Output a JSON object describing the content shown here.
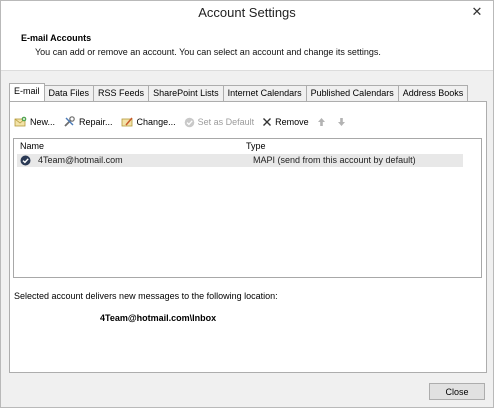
{
  "window": {
    "title": "Account Settings"
  },
  "header": {
    "title": "E-mail Accounts",
    "subtitle": "You can add or remove an account. You can select an account and change its settings."
  },
  "tabs": [
    {
      "label": "E-mail",
      "active": true
    },
    {
      "label": "Data Files"
    },
    {
      "label": "RSS Feeds"
    },
    {
      "label": "SharePoint Lists"
    },
    {
      "label": "Internet Calendars"
    },
    {
      "label": "Published Calendars"
    },
    {
      "label": "Address Books"
    }
  ],
  "toolbar": {
    "new": "New...",
    "repair": "Repair...",
    "change": "Change...",
    "set_default": "Set as Default",
    "remove": "Remove"
  },
  "list": {
    "col_name": "Name",
    "col_type": "Type",
    "rows": [
      {
        "name": "4Team@hotmail.com",
        "type": "MAPI (send from this account by default)"
      }
    ]
  },
  "delivery": {
    "label": "Selected account delivers new messages to the following location:",
    "location": "4Team@hotmail.com\\Inbox"
  },
  "footer": {
    "close": "Close"
  }
}
